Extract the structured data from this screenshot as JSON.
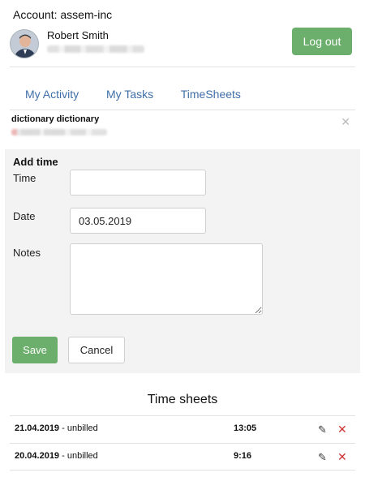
{
  "account": {
    "label": "Account: assem-inc"
  },
  "user": {
    "name": "Robert Smith",
    "logout_label": "Log out"
  },
  "tabs": [
    {
      "label": "My Activity"
    },
    {
      "label": "My Tasks"
    },
    {
      "label": "TimeSheets"
    }
  ],
  "project": {
    "title": "dictionary dictionary",
    "close_icon": "close-icon"
  },
  "add_time": {
    "title": "Add time",
    "time_label": "Time",
    "time_value": "",
    "date_label": "Date",
    "date_value": "03.05.2019",
    "notes_label": "Notes",
    "notes_value": "",
    "save_label": "Save",
    "cancel_label": "Cancel"
  },
  "timesheets": {
    "title": "Time sheets",
    "rows": [
      {
        "date": "21.04.2019",
        "status": " - unbilled",
        "hours": "13:05"
      },
      {
        "date": "20.04.2019",
        "status": " - unbilled",
        "hours": "9:16"
      }
    ]
  },
  "colors": {
    "green": "#6cae6c",
    "link": "#3f6fa8",
    "delete": "#cc3333"
  }
}
